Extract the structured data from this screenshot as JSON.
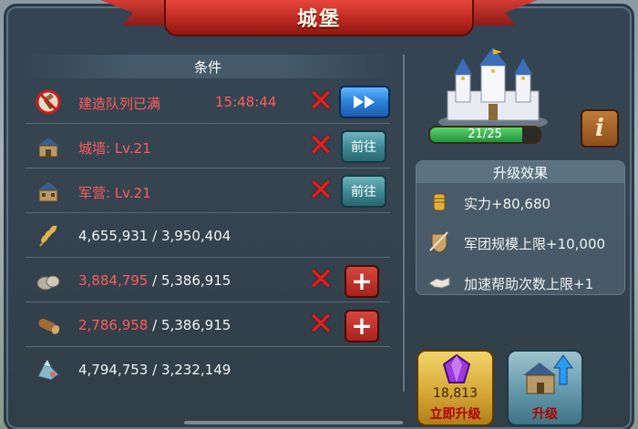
{
  "title": "城堡",
  "conditions": {
    "header": "条件",
    "rows": [
      {
        "label": "建造队列已满",
        "timer": "15:48:44",
        "icon": "hammer-no-icon",
        "met": false,
        "action": "speedup"
      },
      {
        "label": "城墙: Lv.21",
        "icon": "wall-building-icon",
        "met": false,
        "action": "goto",
        "action_label": "前往"
      },
      {
        "label": "军营: Lv.21",
        "icon": "barracks-building-icon",
        "met": false,
        "action": "goto",
        "action_label": "前往"
      },
      {
        "have": "4,655,931",
        "need": "3,950,404",
        "icon": "wheat-icon",
        "met": true
      },
      {
        "have": "3,884,795",
        "need": "5,386,915",
        "icon": "stone-icon",
        "met": false,
        "action": "add",
        "action_label": "+"
      },
      {
        "have": "2,786,958",
        "need": "5,386,915",
        "icon": "wood-log-icon",
        "met": false,
        "action": "add",
        "action_label": "+"
      },
      {
        "have": "4,794,753",
        "need": "3,232,149",
        "icon": "ore-icon",
        "met": true
      }
    ]
  },
  "castle": {
    "progress_text": "21/25",
    "progress": 0.84,
    "info_label": "i"
  },
  "effects": {
    "header": "升级效果",
    "items": [
      {
        "text": "实力+80,680",
        "icon": "power-fist-icon"
      },
      {
        "text": "军团规模上限+10,000",
        "icon": "army-shield-icon"
      },
      {
        "text": "加速帮助次数上限+1",
        "icon": "handshake-icon"
      }
    ]
  },
  "buttons": {
    "instant": {
      "cost": "18,813",
      "label": "立即升级"
    },
    "upgrade": {
      "label": "升级"
    }
  },
  "colors": {
    "unmet": "#ff5c5c",
    "met": "#f2f2f2",
    "banner": "#b8261f"
  }
}
